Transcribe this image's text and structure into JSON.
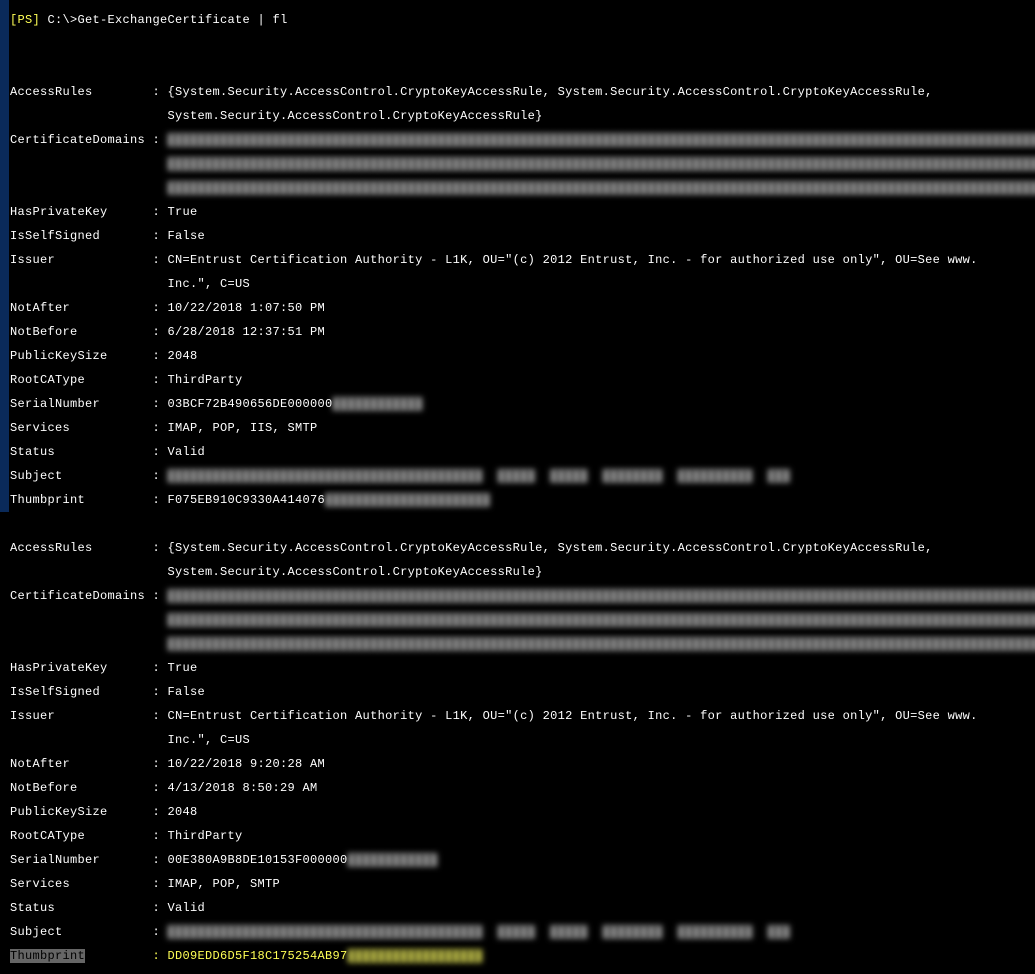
{
  "prompt": {
    "ps": "[PS]",
    "path": " C:\\>",
    "command": "Get-ExchangeCertificate | fl"
  },
  "certs": [
    {
      "AccessRules": "{System.Security.AccessControl.CryptoKeyAccessRule, System.Security.AccessControl.CryptoKeyAccessRule,",
      "AccessRules2": "System.Security.AccessControl.CryptoKeyAccessRule}",
      "CertificateDomains": "",
      "HasPrivateKey": "True",
      "IsSelfSigned": "False",
      "Issuer": "CN=Entrust Certification Authority - L1K, OU=\"(c) 2012 Entrust, Inc. - for authorized use only\", OU=See www.",
      "Issuer2": "Inc.\", C=US",
      "NotAfter": "10/22/2018 1:07:50 PM",
      "NotBefore": "6/28/2018 12:37:51 PM",
      "PublicKeySize": "2048",
      "RootCAType": "ThirdParty",
      "SerialNumber": "03BCF72B490656DE000000",
      "Services": "IMAP, POP, IIS, SMTP",
      "Status": "Valid",
      "Subject": "",
      "Thumbprint": "F075EB910C9330A414076"
    },
    {
      "AccessRules": "{System.Security.AccessControl.CryptoKeyAccessRule, System.Security.AccessControl.CryptoKeyAccessRule,",
      "AccessRules2": "System.Security.AccessControl.CryptoKeyAccessRule}",
      "CertificateDomains": "",
      "HasPrivateKey": "True",
      "IsSelfSigned": "False",
      "Issuer": "CN=Entrust Certification Authority - L1K, OU=\"(c) 2012 Entrust, Inc. - for authorized use only\", OU=See www.",
      "Issuer2": "Inc.\", C=US",
      "NotAfter": "10/22/2018 9:20:28 AM",
      "NotBefore": "4/13/2018 8:50:29 AM",
      "PublicKeySize": "2048",
      "RootCAType": "ThirdParty",
      "SerialNumber": "00E380A9B8DE10153F000000",
      "Services": "IMAP, POP, SMTP",
      "Status": "Valid",
      "Subject": "",
      "Thumbprint_key": "Thumbprint",
      "Thumbprint": "DD09EDD6D5F18C175254AB97"
    }
  ]
}
